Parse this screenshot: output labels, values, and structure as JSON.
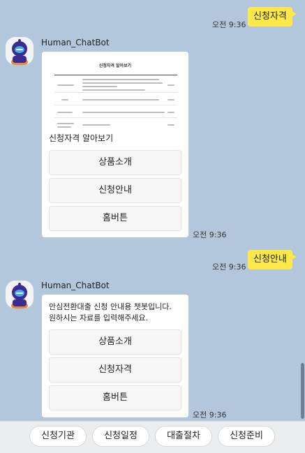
{
  "messages": [
    {
      "type": "user",
      "text": "신청자격",
      "time": "오전 9:36"
    },
    {
      "type": "bot",
      "sender": "Human_ChatBot",
      "preview": {
        "title": "신청자격 알아보기"
      },
      "text": "신청자격 알아보기",
      "buttons": [
        "상품소개",
        "신청안내",
        "홈버튼"
      ],
      "time": "오전 9:36"
    },
    {
      "type": "user",
      "text": "신청안내",
      "time": "오전 9:36"
    },
    {
      "type": "bot",
      "sender": "Human_ChatBot",
      "text_lines": [
        "안심전환대출 신청 안내용 챗봇입니다.",
        "원하시는 자료를 입력해주세요."
      ],
      "buttons": [
        "상품소개",
        "신청자격",
        "홈버튼"
      ],
      "time": "오전 9:36"
    }
  ],
  "quick_replies": [
    "신청기관",
    "신청일정",
    "대출절차",
    "신청준비"
  ],
  "colors": {
    "chat_bg": "#b3c7dc",
    "user_bubble": "#fde84a",
    "bot_bubble": "#ffffff",
    "avatar_body": "#3b2b8f",
    "avatar_face": "#4aa8e8"
  }
}
